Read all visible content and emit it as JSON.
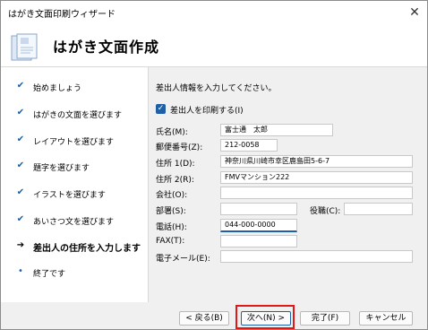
{
  "window": {
    "title": "はがき文面印刷ウィザード",
    "close_glyph": "✕"
  },
  "header": {
    "heading": "はがき文面作成"
  },
  "sidebar": {
    "steps": [
      {
        "mark": "✔",
        "label": "始めましょう"
      },
      {
        "mark": "✔",
        "label": "はがきの文面を選びます"
      },
      {
        "mark": "✔",
        "label": "レイアウトを選びます"
      },
      {
        "mark": "✔",
        "label": "題字を選びます"
      },
      {
        "mark": "✔",
        "label": "イラストを選びます"
      },
      {
        "mark": "✔",
        "label": "あいさつ文を選びます"
      },
      {
        "mark": "➔",
        "label": "差出人の住所を入力します"
      },
      {
        "mark": "•",
        "label": "終了です"
      }
    ]
  },
  "form": {
    "instruction": "差出人情報を入力してください。",
    "print_sender_label": "差出人を印刷する(I)",
    "print_sender_checked": true,
    "name_label": "氏名(M):",
    "name_value": "富士通　太郎",
    "postal_label": "郵便番号(Z):",
    "postal_value": "212-0058",
    "address1_label": "住所 1(D):",
    "address1_value": "神奈川県川崎市幸区鹿島田5-6-7",
    "address2_label": "住所 2(R):",
    "address2_value": "FMVマンション222",
    "company_label": "会社(O):",
    "company_value": "",
    "department_label": "部署(S):",
    "department_value": "",
    "position_label": "役職(C):",
    "position_value": "",
    "phone_label": "電話(H):",
    "phone_value": "044-000-0000",
    "fax_label": "FAX(T):",
    "fax_value": "",
    "email_label": "電子メール(E):",
    "email_value": ""
  },
  "buttons": {
    "back": "< 戻る(B)",
    "next": "次へ(N) >",
    "finish": "完了(F)",
    "cancel": "キャンセル"
  },
  "colors": {
    "accent": "#1f5fa8",
    "highlight": "#e01818"
  }
}
